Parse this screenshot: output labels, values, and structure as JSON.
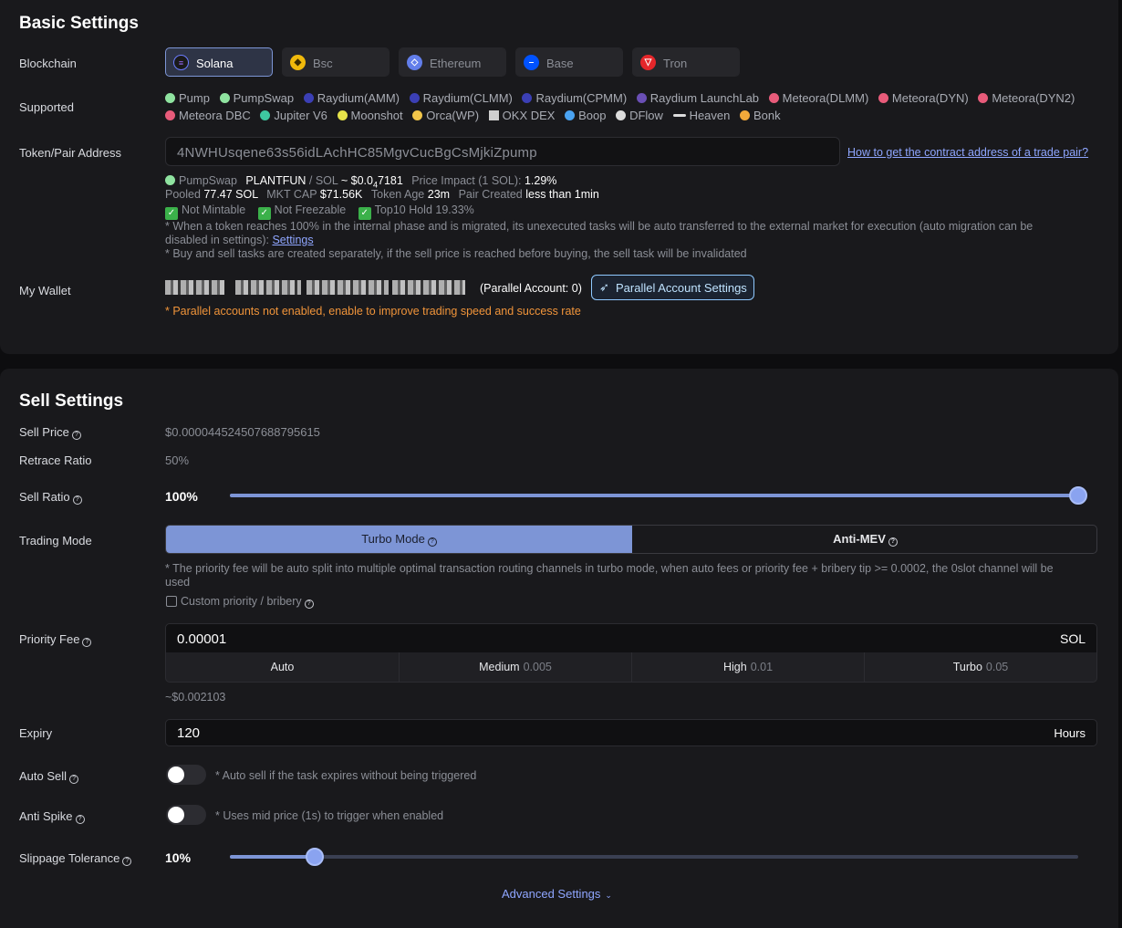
{
  "basic": {
    "title": "Basic Settings",
    "blockchain_label": "Blockchain",
    "chains": [
      {
        "name": "Solana",
        "icon": "solana-icon",
        "color": "#1a1a1a",
        "active": true
      },
      {
        "name": "Bsc",
        "icon": "bnb-icon",
        "color": "#f0b90b",
        "active": false
      },
      {
        "name": "Ethereum",
        "icon": "ethereum-icon",
        "color": "#627eea",
        "active": false
      },
      {
        "name": "Base",
        "icon": "base-icon",
        "color": "#0052ff",
        "active": false
      },
      {
        "name": "Tron",
        "icon": "tron-icon",
        "color": "#e5262a",
        "active": false
      }
    ],
    "supported_label": "Supported",
    "dexes_row1": [
      "Pump",
      "PumpSwap",
      "Raydium(AMM)",
      "Raydium(CLMM)",
      "Raydium(CPMM)",
      "Raydium LaunchLab",
      "Meteora(DLMM)",
      "Meteora(DYN)",
      "Meteora(DYN2)"
    ],
    "dexes_row2": [
      "Meteora DBC",
      "Jupiter V6",
      "Moonshot",
      "Orca(WP)",
      "OKX DEX",
      "Boop",
      "DFlow",
      "Heaven",
      "Bonk"
    ],
    "token_label": "Token/Pair Address",
    "token_value": "4NWHUsqene63s56idLAchHC85MgvCucBgCsMjkiZpump",
    "help_link": "How to get the contract address of a trade pair?",
    "pair": {
      "dex": "PumpSwap",
      "token": "PLANTFUN",
      "quote": "/ SOL",
      "price_prefix": "~ $0.0",
      "price_sub": "4",
      "price_rest": "7181",
      "impact_label": "Price Impact (1 SOL):",
      "impact_value": "1.29%",
      "pooled_label": "Pooled",
      "pooled_value": "77.47 SOL",
      "mcap_label": "MKT CAP",
      "mcap_value": "$71.56K",
      "age_label": "Token Age",
      "age_value": "23m",
      "created_label": "Pair Created",
      "created_value": "less than 1min"
    },
    "checks": [
      "Not Mintable",
      "Not Freezable",
      "Top10 Hold 19.33%"
    ],
    "note1": "* When a token reaches 100% in the internal phase and is migrated, its unexecuted tasks will be auto transferred to the external market for execution (auto migration can be",
    "note1b": "disabled in settings): ",
    "note1_link": "Settings",
    "note2": "* Buy and sell tasks are created separately, if the sell price is reached before buying, the sell task will be invalidated",
    "wallet_label": "My Wallet",
    "parallel_count": "(Parallel Account: 0)",
    "parallel_btn": "Parallel Account Settings",
    "parallel_warning": "* Parallel accounts not enabled, enable to improve trading speed and success rate"
  },
  "sell": {
    "title": "Sell Settings",
    "price_label": "Sell Price",
    "price_value": "$0.000044524507688795615",
    "retrace_label": "Retrace Ratio",
    "retrace_value": "50%",
    "ratio_label": "Sell Ratio",
    "ratio_value": "100%",
    "ratio_fraction": 1.0,
    "mode_label": "Trading Mode",
    "mode_turbo": "Turbo Mode",
    "mode_antimev": "Anti-MEV",
    "turbo_note": "* The priority fee will be auto split into multiple optimal transaction routing channels in turbo mode, when auto fees or priority fee + bribery tip >= 0.0002, the 0slot channel will be",
    "turbo_note2": "used",
    "custom_label": "Custom priority / bribery",
    "fee_label": "Priority Fee",
    "fee_value": "0.00001",
    "fee_unit": "SOL",
    "tiers": [
      {
        "name": "Auto",
        "val": ""
      },
      {
        "name": "Medium",
        "val": "0.005"
      },
      {
        "name": "High",
        "val": "0.01"
      },
      {
        "name": "Turbo",
        "val": "0.05"
      }
    ],
    "fee_usd": "~$0.002103",
    "expiry_label": "Expiry",
    "expiry_value": "120",
    "expiry_unit": "Hours",
    "autosell_label": "Auto Sell",
    "autosell_note": "* Auto sell if the task expires without being triggered",
    "antispike_label": "Anti Spike",
    "antispike_note": "* Uses mid price (1s) to trigger when enabled",
    "slippage_label": "Slippage Tolerance",
    "slippage_value": "10%",
    "slippage_fraction": 0.1,
    "advanced": "Advanced Settings"
  }
}
